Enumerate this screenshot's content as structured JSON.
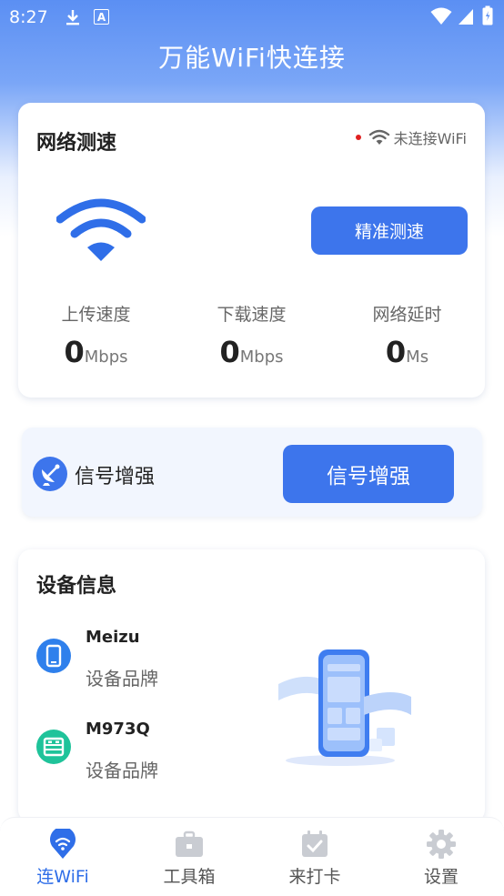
{
  "status_bar": {
    "time": "8:27",
    "a_badge": "A"
  },
  "app": {
    "title": "万能WiFi快连接"
  },
  "speed_test": {
    "title": "网络测速",
    "connection_status": "未连接WiFi",
    "measure_button": "精准测速",
    "stats": [
      {
        "label": "上传速度",
        "value": "0",
        "unit": "Mbps"
      },
      {
        "label": "下载速度",
        "value": "0",
        "unit": "Mbps"
      },
      {
        "label": "网络延时",
        "value": "0",
        "unit": "Ms"
      }
    ]
  },
  "signal": {
    "label": "信号增强",
    "button": "信号增强"
  },
  "device_info": {
    "title": "设备信息",
    "items": [
      {
        "name": "Meizu",
        "sub": "设备品牌"
      },
      {
        "name": "M973Q",
        "sub": "设备品牌"
      }
    ]
  },
  "tabs": [
    {
      "label": "连WiFi",
      "icon": "wifi-pin-icon",
      "active": true
    },
    {
      "label": "工具箱",
      "icon": "toolbox-icon",
      "active": false
    },
    {
      "label": "来打卡",
      "icon": "calendar-check-icon",
      "active": false
    },
    {
      "label": "设置",
      "icon": "gear-icon",
      "active": false
    }
  ],
  "colors": {
    "accent": "#3d75ec",
    "active_tab": "#2f6ee8",
    "alert_dot": "#e02020"
  }
}
